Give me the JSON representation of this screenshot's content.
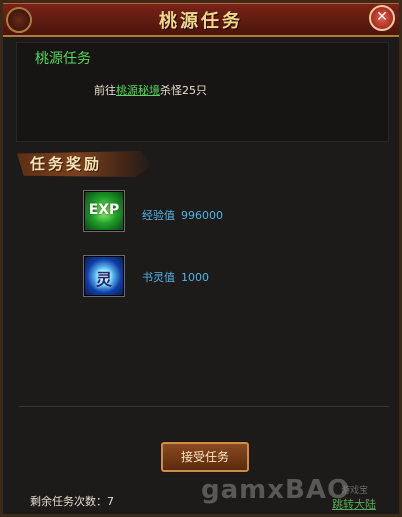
{
  "window": {
    "title": "桃源任务"
  },
  "task": {
    "name": "桃源任务",
    "desc_prefix": "前往",
    "desc_link": "桃源秘境",
    "desc_suffix": "杀怪25只"
  },
  "rewards": {
    "header": "任务奖励",
    "items": [
      {
        "icon": "exp-icon",
        "icon_text": "EXP",
        "label": "经验值",
        "value": "996000"
      },
      {
        "icon": "spirit-icon",
        "icon_text": "灵",
        "label": "书灵值",
        "value": "1000"
      }
    ]
  },
  "footer": {
    "accept_label": "接受任务",
    "remaining_label": "剩余任务次数：",
    "remaining_count": "7"
  },
  "watermark": {
    "main": "gamxBAO",
    "small": "游戏宝",
    "green": "跳转大陆"
  },
  "colors": {
    "title_text": "#f2d78b",
    "task_title": "#57d85a",
    "reward_text": "#4fb3e6",
    "button_border": "#c98e4a"
  }
}
